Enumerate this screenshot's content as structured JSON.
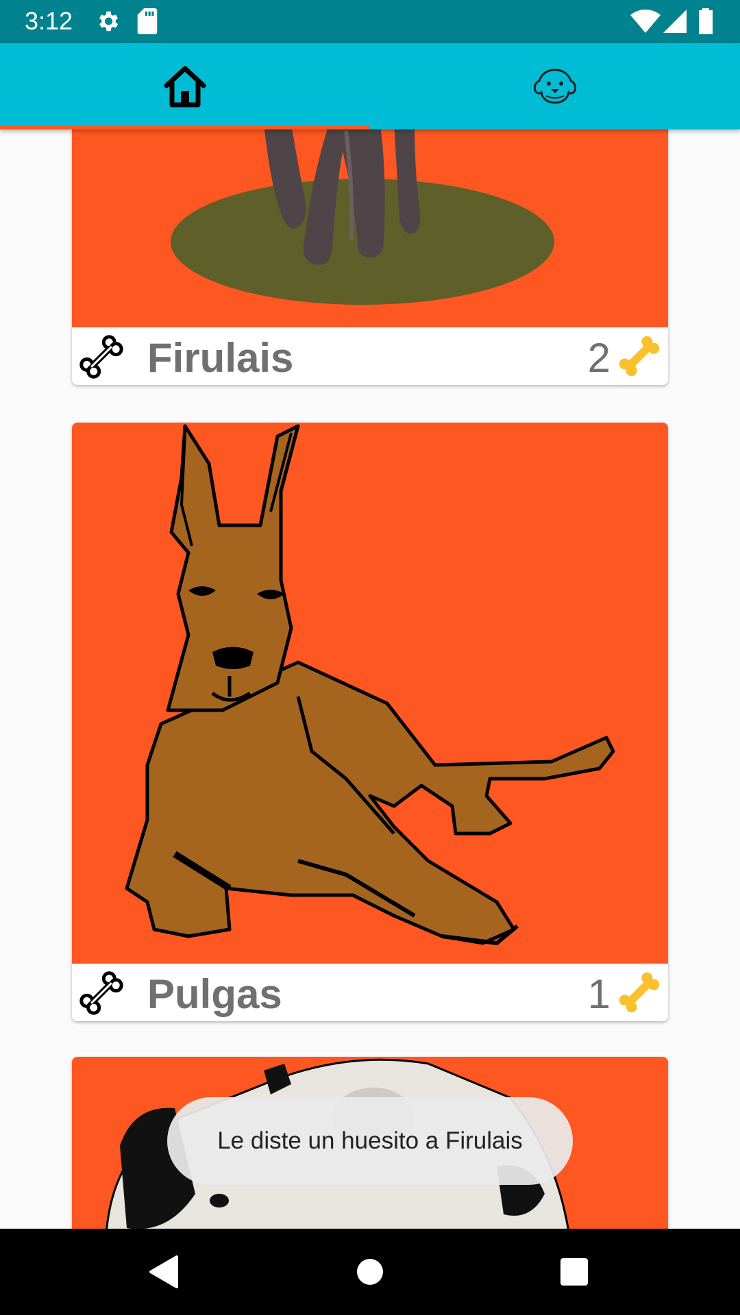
{
  "status_bar": {
    "time": "3:12",
    "icons": [
      "settings-icon",
      "sd-card-icon",
      "wifi-icon",
      "signal-icon",
      "battery-icon"
    ]
  },
  "tabs": [
    {
      "icon": "home-icon",
      "selected": true
    },
    {
      "icon": "dog-face-icon",
      "selected": false
    }
  ],
  "pets": [
    {
      "name": "Firulais",
      "likes": "2"
    },
    {
      "name": "Pulgas",
      "likes": "1"
    },
    {
      "name": "",
      "likes": ""
    }
  ],
  "toast": {
    "message": "Le diste un huesito a Firulais"
  },
  "nav_bar": {
    "icons": [
      "back-icon",
      "home-circle-icon",
      "recents-icon"
    ]
  },
  "colors": {
    "status_bar": "#00838f",
    "tab_bar": "#00bcd4",
    "accent": "#ff5722",
    "card_background": "#ff5722",
    "bone_gold": "#fbc02d"
  }
}
